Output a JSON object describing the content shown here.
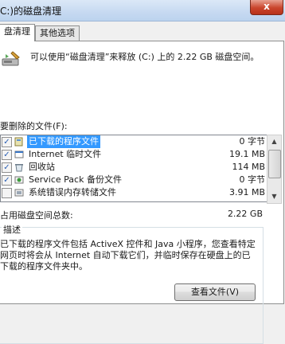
{
  "window": {
    "title": "C:)的磁盘清理",
    "close_glyph": "x"
  },
  "tabs": [
    {
      "label": "盘清理",
      "active": true
    },
    {
      "label": "其他选项",
      "active": false
    }
  ],
  "summary": {
    "icon": "disk-cleanup-icon",
    "text": "可以使用“磁盘清理”来释放 (C:) 上的 2.22 GB 磁盘空间。"
  },
  "files_label": "要删除的文件(F):",
  "files": [
    {
      "checked": true,
      "icon": "downloaded-programs-icon",
      "name": "已下载的程序文件",
      "size": "0 字节",
      "selected": true
    },
    {
      "checked": true,
      "icon": "internet-temp-icon",
      "name": "Internet 临时文件",
      "size": "19.1 MB",
      "selected": false
    },
    {
      "checked": true,
      "icon": "recycle-bin-icon",
      "name": "回收站",
      "size": "114 MB",
      "selected": false
    },
    {
      "checked": true,
      "icon": "service-pack-icon",
      "name": "Service Pack 备份文件",
      "size": "0 字节",
      "selected": false
    },
    {
      "checked": false,
      "icon": "error-memory-dump-icon",
      "name": "系统错误内存转储文件",
      "size": "3.91 MB",
      "selected": false
    }
  ],
  "total": {
    "label": "占用磁盘空间总数:",
    "value": "2.22 GB"
  },
  "description": {
    "label": "描述",
    "text": "已下载的程序文件包括 ActiveX 控件和 Java 小程序，您查看特定网页时将会从 Internet 自动下载它们，并临时保存在硬盘上的已下载的程序文件夹中。"
  },
  "view_files_button": "查看文件(V)",
  "colors": {
    "selection": "#3399ff",
    "close": "#c9452c"
  }
}
